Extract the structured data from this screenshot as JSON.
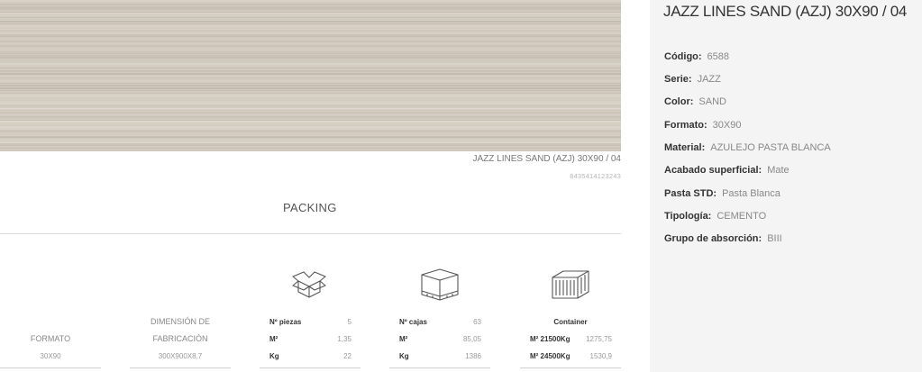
{
  "product": {
    "image_caption": "JAZZ LINES SAND (AZJ) 30X90 / 04",
    "ean": "8435414123243",
    "title": "JAZZ LINES SAND (AZJ) 30X90 / 04",
    "specs": [
      {
        "label": "Código:",
        "value": "6588"
      },
      {
        "label": "Serie:",
        "value": "JAZZ"
      },
      {
        "label": "Color:",
        "value": "SAND"
      },
      {
        "label": "Formato:",
        "value": "30X90"
      },
      {
        "label": "Material:",
        "value": "AZULEJO PASTA BLANCA"
      },
      {
        "label": "Acabado superficial:",
        "value": "Mate"
      },
      {
        "label": "Pasta STD:",
        "value": "Pasta Blanca"
      },
      {
        "label": "Tipología:",
        "value": "CEMENTO"
      },
      {
        "label": "Grupo de absorción:",
        "value": "BIII"
      }
    ]
  },
  "packing": {
    "title": "PACKING",
    "formato": {
      "label": "FORMATO",
      "value": "30X90"
    },
    "dimension": {
      "label_line1": "DIMENSIÓN DE",
      "label_line2": "FABRICACIÓN",
      "value": "300X900X8,7"
    },
    "piezas": {
      "icon": "open-box-icon",
      "rows": [
        {
          "k": "Nº piezas",
          "v": "5"
        },
        {
          "k": "M²",
          "v": "1,35"
        },
        {
          "k": "Kg",
          "v": "22"
        }
      ]
    },
    "cajas": {
      "icon": "pallet-icon",
      "rows": [
        {
          "k": "Nº cajas",
          "v": "63"
        },
        {
          "k": "M²",
          "v": "85,05"
        },
        {
          "k": "Kg",
          "v": "1386"
        }
      ]
    },
    "container": {
      "icon": "container-icon",
      "title": "Container",
      "rows": [
        {
          "k": "M² 21500Kg",
          "v": "1275,75"
        },
        {
          "k": "M² 24500Kg",
          "v": "1530,9"
        }
      ]
    }
  },
  "colors": {
    "tile": "#d2cbc0",
    "panel": "#f4f4f4",
    "text_dark": "#333333",
    "text_light": "#888888"
  }
}
